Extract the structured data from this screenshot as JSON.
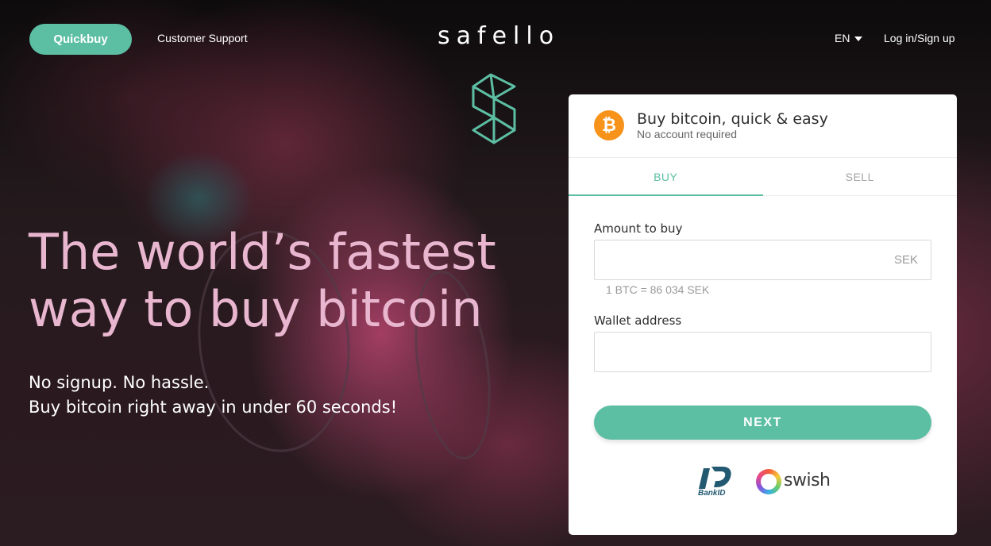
{
  "header": {
    "quickbuy_label": "Quickbuy",
    "support_label": "Customer Support",
    "logo_text": "safello",
    "language": "EN",
    "login_label": "Log in/Sign up"
  },
  "hero": {
    "headline_line1": "The world’s fastest",
    "headline_line2": "way to buy bitcoin",
    "subtitle_line1": "No signup. No hassle.",
    "subtitle_line2": "Buy bitcoin right away in under 60 seconds!"
  },
  "card": {
    "title": "Buy bitcoin, quick & easy",
    "subtitle": "No account required",
    "btc_symbol": "₿",
    "tabs": [
      {
        "label": "BUY",
        "active": true
      },
      {
        "label": "SELL",
        "active": false
      }
    ],
    "amount_label": "Amount to buy",
    "amount_value": "",
    "amount_currency": "SEK",
    "rate_text": "1 BTC = 86 034 SEK",
    "wallet_label": "Wallet address",
    "wallet_value": "",
    "next_label": "NEXT",
    "payment_methods": {
      "bankid_label": "BankID",
      "swish_label": "swish"
    }
  },
  "colors": {
    "accent": "#5cbea3",
    "headline": "#e9b6cf",
    "bitcoin": "#f7931a"
  },
  "icons": {
    "logo_mark": "safello-s-icon",
    "bitcoin": "bitcoin-icon",
    "language_caret": "caret-down-icon"
  }
}
